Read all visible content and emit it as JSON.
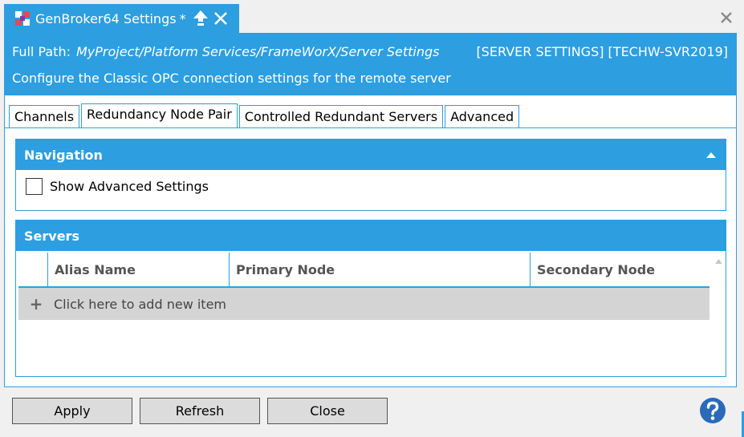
{
  "window": {
    "tab_title": "GenBroker64 Settings",
    "modified_mark": "*",
    "icons": {
      "app": "genbroker-app-icon",
      "pin": "pin-up-arrow-icon",
      "tab_close": "close-icon",
      "window_close": "close-icon"
    }
  },
  "header": {
    "path_label": "Full Path:",
    "path_value": "MyProject/Platform Services/FrameWorX/Server Settings",
    "tag": "[SERVER SETTINGS] [TECHW-SVR2019]",
    "description": "Configure the Classic OPC connection settings for the remote server"
  },
  "tabs": [
    {
      "label": "Channels",
      "active": false
    },
    {
      "label": "Redundancy Node Pair",
      "active": true
    },
    {
      "label": "Controlled Redundant Servers",
      "active": false
    },
    {
      "label": "Advanced",
      "active": false
    }
  ],
  "navigation": {
    "title": "Navigation",
    "show_advanced_label": "Show Advanced Settings",
    "show_advanced_checked": false
  },
  "servers": {
    "title": "Servers",
    "columns": [
      "",
      "Alias Name",
      "Primary Node",
      "Secondary Node"
    ],
    "add_row_label": "Click here to add new item",
    "rows": []
  },
  "buttons": {
    "apply": "Apply",
    "refresh": "Refresh",
    "close": "Close"
  },
  "colors": {
    "accent": "#2d9ee0",
    "help": "#2a6ab8"
  }
}
